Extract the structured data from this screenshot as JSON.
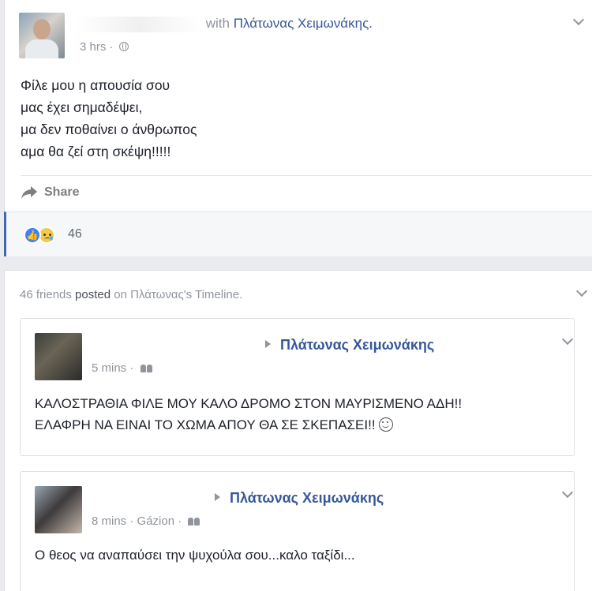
{
  "post": {
    "with_text": "with",
    "tagged_name": "Πλάτωνας Χειμωνάκης.",
    "time": "3 hrs",
    "time_sep": "·",
    "privacy_icon": "globe-icon",
    "message_lines": [
      "Φίλε μου η απουσία σου",
      "μας έχει σημαδέψει,",
      "μα δεν ποθαίνει ο άνθρωπος",
      "αμα θα ζεί στη σκέψη!!!!!"
    ],
    "share_label": "Share",
    "reaction_icons": [
      "like-icon",
      "sad-icon"
    ],
    "reaction_count": "46"
  },
  "timeline": {
    "friends_count": "46 friends",
    "posted": "posted",
    "on_text": "on",
    "timeline_owner": "Πλάτωνας's Timeline."
  },
  "subposts": [
    {
      "name": "Πλάτωνας Χειμωνάκης",
      "time": "5 mins",
      "location": "",
      "sep": "·",
      "lines": [
        "ΚΑΛΟΣΤΡΑΘΙΑ ΦΙΛΕ ΜΟΥ ΚΑΛΟ ΔΡΟΜΟ ΣΤΟΝ ΜΑΥΡΙΣΜΕΝΟ ΑΔΗ!!",
        "ΕΛΑΦΡΗ ΝΑ ΕΙΝΑΙ ΤΟ ΧΩΜΑ ΑΠΟΥ ΘΑ ΣΕ ΣΚΕΠΑΣΕΙ!!"
      ]
    },
    {
      "name": "Πλάτωνας Χειμωνάκης",
      "time": "8 mins",
      "location": "Gázion",
      "sep": "·",
      "lines": [
        "Ο θεος να αναπαύσει την ψυχούλα σου...καλο ταξίδι..."
      ]
    }
  ],
  "colors": {
    "link": "#365899",
    "meta": "#90949c",
    "accent": "#4267b2",
    "background": "#e9ebee"
  }
}
